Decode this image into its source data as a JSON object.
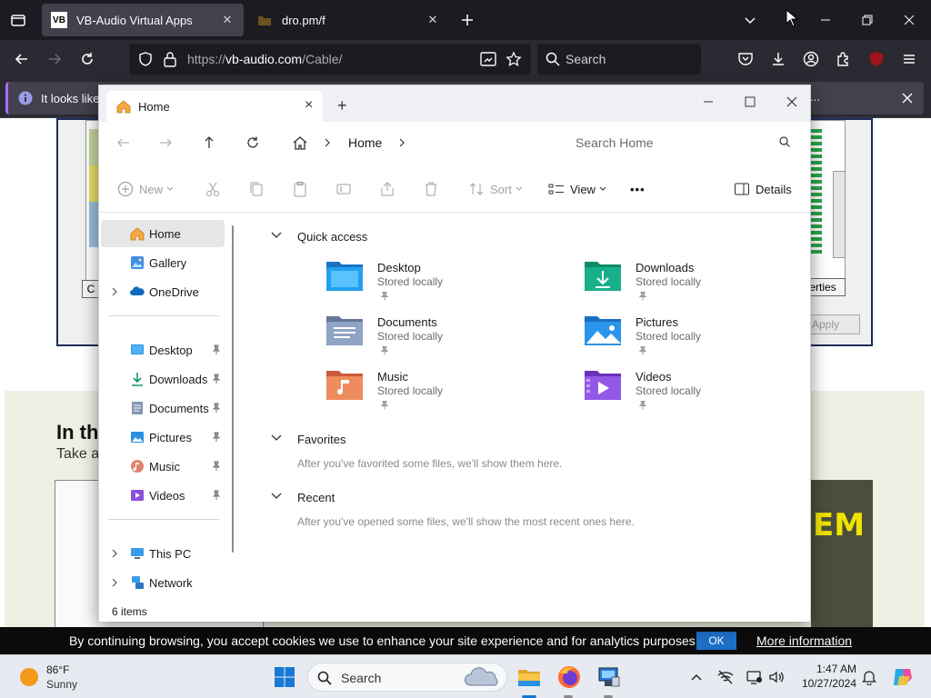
{
  "browser": {
    "tabs": [
      {
        "title": "VB-Audio Virtual Apps",
        "favicon": "VB"
      },
      {
        "title": "dro.pm/f"
      }
    ],
    "url": {
      "scheme": "https://",
      "host": "vb-audio.com",
      "path": "/Cable/"
    },
    "search_placeholder": "Search",
    "extension_badge": "91",
    "notice_text": "It looks like",
    "notice_ellipsis": "..."
  },
  "webpage": {
    "heading": "In the",
    "subheading": "Take a",
    "properties_btn": "erties",
    "apply_btn": "Apply",
    "thumb_text": "EM"
  },
  "cookie_bar": {
    "text": "By continuing browsing, you accept cookies we use to enhance your site experience and for analytics purposes.",
    "ok": "OK",
    "more": "More information"
  },
  "explorer": {
    "tab_title": "Home",
    "breadcrumb_home": "Home",
    "search_placeholder": "Search Home",
    "commands": {
      "new": "New",
      "sort": "Sort",
      "view": "View",
      "more": "•••",
      "details": "Details"
    },
    "nav": {
      "top": [
        {
          "label": "Home"
        },
        {
          "label": "Gallery"
        },
        {
          "label": "OneDrive"
        }
      ],
      "pinned": [
        {
          "label": "Desktop"
        },
        {
          "label": "Downloads"
        },
        {
          "label": "Documents"
        },
        {
          "label": "Pictures"
        },
        {
          "label": "Music"
        },
        {
          "label": "Videos"
        }
      ],
      "bottom": [
        {
          "label": "This PC"
        },
        {
          "label": "Network"
        }
      ]
    },
    "sections": {
      "quick_access": "Quick access",
      "favorites": "Favorites",
      "favorites_note": "After you've favorited some files, we'll show them here.",
      "recent": "Recent",
      "recent_note": "After you've opened some files, we'll show the most recent ones here."
    },
    "quick_access_items": [
      {
        "name": "Desktop",
        "status": "Stored locally",
        "color": "#1a8fe3"
      },
      {
        "name": "Downloads",
        "status": "Stored locally",
        "color": "#15a37a"
      },
      {
        "name": "Documents",
        "status": "Stored locally",
        "color": "#7d93b8"
      },
      {
        "name": "Pictures",
        "status": "Stored locally",
        "color": "#2a8fe0"
      },
      {
        "name": "Music",
        "status": "Stored locally",
        "color": "#e67a4f"
      },
      {
        "name": "Videos",
        "status": "Stored locally",
        "color": "#8c4fd9"
      }
    ],
    "status_text": "6 items"
  },
  "taskbar": {
    "temperature": "86°F",
    "condition": "Sunny",
    "search_label": "Search",
    "time": "1:47 AM",
    "date": "10/27/2024"
  }
}
